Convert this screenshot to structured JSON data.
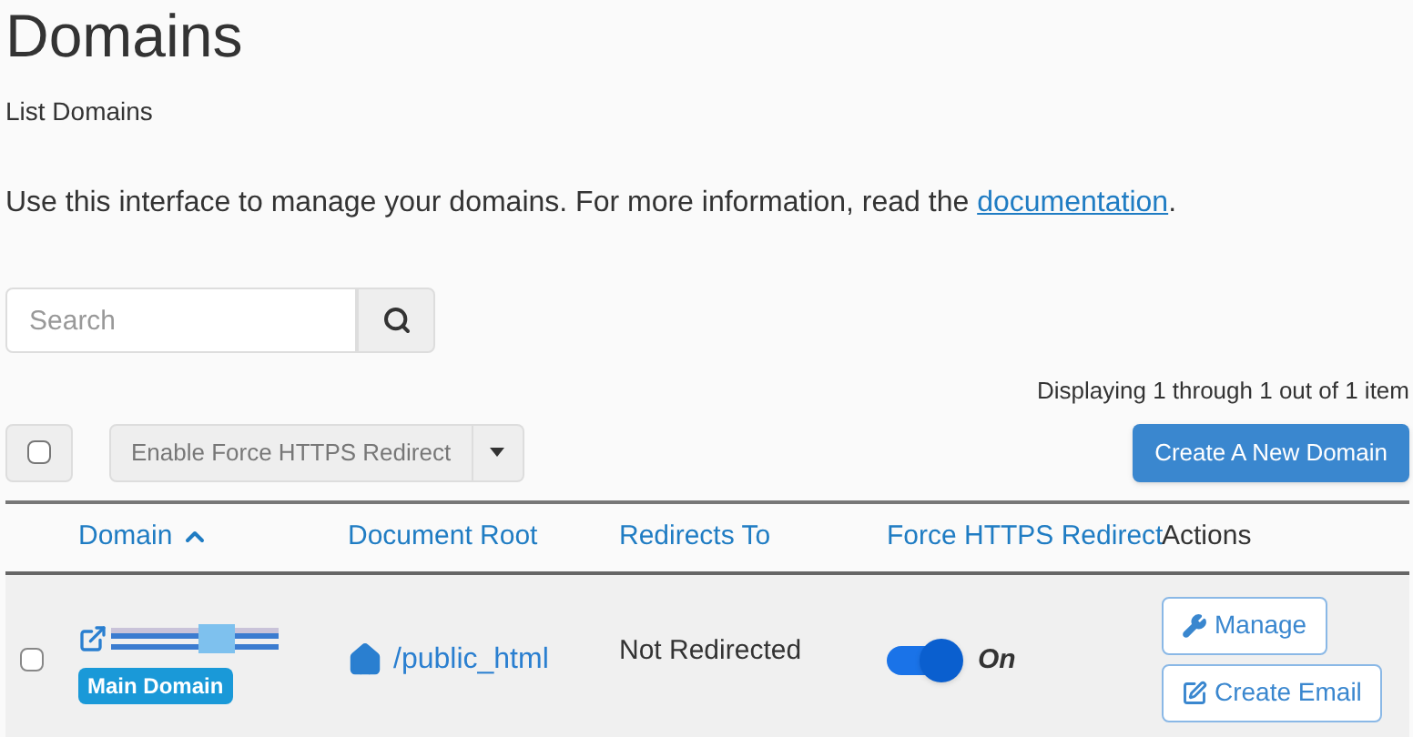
{
  "page": {
    "title": "Domains",
    "subtitle": "List Domains",
    "intro": {
      "text": "Use this interface to manage your domains. For more information, read the",
      "link": "documentation",
      "end": "."
    }
  },
  "search": {
    "placeholder": "Search"
  },
  "paging": "Displaying 1 through 1 out of 1 item",
  "toolbar": {
    "select_all_checked": false,
    "bulk_action": "Enable Force HTTPS Redirect",
    "create_button": "Create A New Domain"
  },
  "table": {
    "columns": [
      {
        "label": "Domain",
        "sorted": true,
        "kind": "link"
      },
      {
        "label": "Document Root",
        "sorted": false,
        "kind": "link"
      },
      {
        "label": "Redirects To",
        "sorted": false,
        "kind": "link"
      },
      {
        "label": "Force HTTPS Redirect",
        "sorted": false,
        "kind": "link"
      },
      {
        "label": "Actions",
        "kind": "plain"
      }
    ],
    "rows": [
      {
        "checked": false,
        "badge": "Main Domain",
        "document_root": "/public_html",
        "redirects_to": "Not Redirected",
        "force_https": {
          "on": true,
          "label": "On"
        },
        "actions": [
          "Manage",
          "Create Email"
        ]
      }
    ]
  }
}
